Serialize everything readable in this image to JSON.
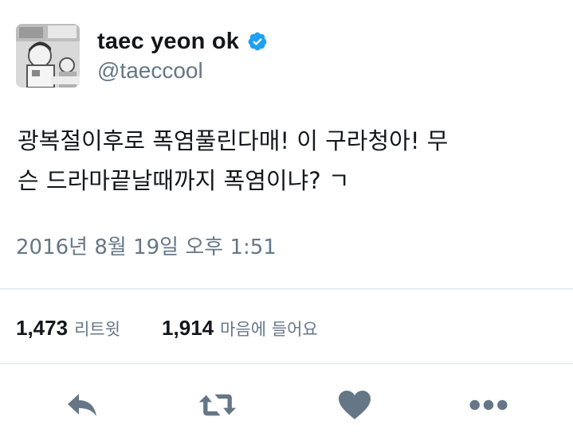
{
  "user": {
    "display_name": "taec yeon ok",
    "handle": "@taeccool",
    "verified": true
  },
  "tweet": {
    "text": "광복절이후로 폭염풀린다매! 이 구라청아! 무\n슨 드라마끝날때까지 폭염이냐? ㄱ",
    "timestamp": "2016년 8월 19일 오후 1:51"
  },
  "stats": {
    "retweets_count": "1,473",
    "retweets_label": "리트윗",
    "likes_count": "1,914",
    "likes_label": "마음에 들어요"
  },
  "actions": [
    "reply-icon",
    "retweet-icon",
    "heart-icon",
    "more-icon"
  ],
  "colors": {
    "text": "#14171a",
    "secondary": "#657786",
    "divider": "#e6ecf0",
    "verified": "#1da1f2",
    "icon": "#657786"
  }
}
